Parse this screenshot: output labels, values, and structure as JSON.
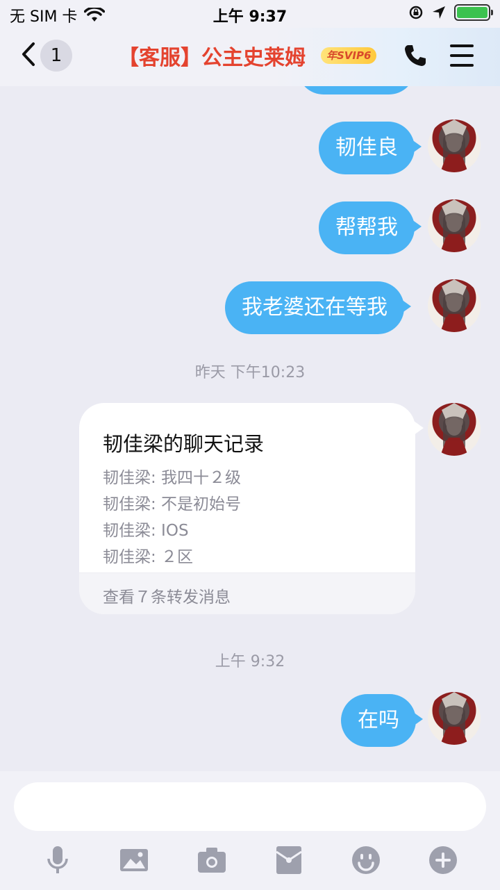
{
  "status_bar": {
    "carrier": "无 SIM 卡",
    "time": "上午 9:37",
    "icons": [
      "wifi-icon",
      "rotation-lock-icon",
      "location-icon",
      "battery-charging-icon"
    ]
  },
  "header": {
    "unread_count": "1",
    "title": "【客服】公主史莱姆",
    "badge": "年SVIP6"
  },
  "messages": [
    {
      "type": "text",
      "side": "right",
      "text": "韧佳良"
    },
    {
      "type": "text",
      "side": "right",
      "text": "帮帮我"
    },
    {
      "type": "text",
      "side": "right",
      "text": "我老婆还在等我"
    },
    {
      "type": "timestamp",
      "text": "昨天 下午10:23"
    },
    {
      "type": "forward_card",
      "side": "right",
      "title": "韧佳梁的聊天记录",
      "lines": [
        "韧佳梁: 我四十２级",
        "韧佳梁: 不是初始号",
        "韧佳梁: IOS",
        "韧佳梁: ２区"
      ],
      "footer": "查看７条转发消息"
    },
    {
      "type": "timestamp",
      "text": "上午 9:32"
    },
    {
      "type": "text",
      "side": "right",
      "text": "在吗"
    }
  ],
  "input": {
    "placeholder": ""
  },
  "toolbar": [
    "microphone-icon",
    "image-icon",
    "camera-icon",
    "red-packet-icon",
    "emoji-icon",
    "plus-icon"
  ],
  "colors": {
    "bubble": "#4ab3f4",
    "title": "#e4432f",
    "background": "#ebebf3"
  }
}
